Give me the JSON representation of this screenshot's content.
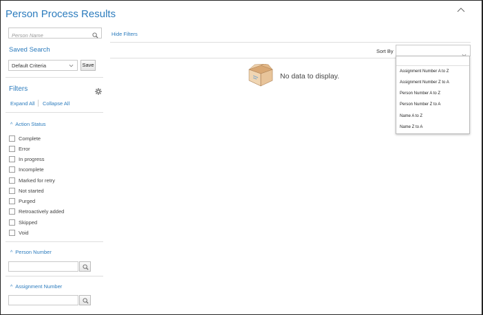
{
  "page": {
    "title": "Person Process Results"
  },
  "search": {
    "placeholder": "Person Name"
  },
  "saved_search": {
    "label": "Saved Search",
    "selected": "Default Criteria",
    "save_label": "Save"
  },
  "filters": {
    "title": "Filters",
    "expand_all": "Expand All",
    "collapse_all": "Collapse All"
  },
  "action_status": {
    "heading": "Action Status",
    "options": [
      "Complete",
      "Error",
      "In progress",
      "Incomplete",
      "Marked for retry",
      "Not started",
      "Purged",
      "Retroactively added",
      "Skipped",
      "Void"
    ]
  },
  "person_number": {
    "heading": "Person Number"
  },
  "assignment_number": {
    "heading": "Assignment Number"
  },
  "results": {
    "hide_filters": "Hide Filters",
    "sort_by_label": "Sort By",
    "sort_selected": "",
    "sort_options": [
      "Assignment Number A to Z",
      "Assignment Number Z to A",
      "Person Number A to Z",
      "Person Number Z to A",
      "Name A to Z",
      "Name Z to A"
    ],
    "empty_message": "No data to display."
  },
  "colors": {
    "accent": "#2b7bbd",
    "border": "#c8c8c8"
  }
}
